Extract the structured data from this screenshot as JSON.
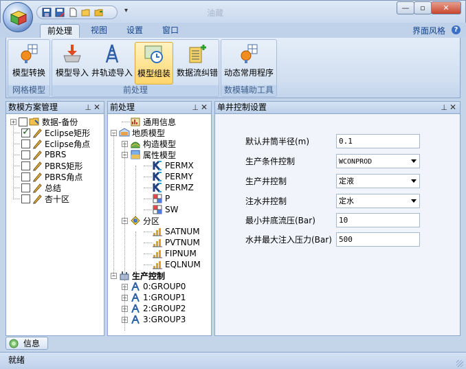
{
  "window": {
    "title": "油藏"
  },
  "qat": {
    "more_label": "▾"
  },
  "ribbon_tabs": [
    "前处理",
    "视图",
    "设置",
    "窗口"
  ],
  "ribbon_right": {
    "style_label": "界面风格",
    "help_label": "?"
  },
  "ribbon": {
    "groups": [
      {
        "label": "网格模型",
        "buttons": [
          "模型转换"
        ]
      },
      {
        "label": "前处理",
        "buttons": [
          "模型导入",
          "井轨迹导入",
          "模型组装",
          "数据流纠错"
        ]
      },
      {
        "label": "数模辅助工具",
        "buttons": [
          "动态常用程序"
        ]
      }
    ],
    "active_button": "模型组装"
  },
  "panels": {
    "scheme": {
      "title": "数模方案管理"
    },
    "pre": {
      "title": "前处理"
    },
    "well": {
      "title": "单井控制设置"
    }
  },
  "scheme_tree": [
    {
      "label": "数据-备份",
      "checked": false
    },
    {
      "label": "Eclipse矩形",
      "checked": true
    },
    {
      "label": "Eclipse角点",
      "checked": false
    },
    {
      "label": "PBRS",
      "checked": false
    },
    {
      "label": "PBRS矩形",
      "checked": false
    },
    {
      "label": "PBRS角点",
      "checked": false
    },
    {
      "label": "总结",
      "checked": false
    },
    {
      "label": "杏十区",
      "checked": false
    }
  ],
  "pre_tree": {
    "general": "通用信息",
    "geo": "地质模型",
    "structure": "构造模型",
    "property": "属性模型",
    "props": [
      "PERMX",
      "PERMY",
      "PERMZ",
      "P",
      "SW"
    ],
    "zone": "分区",
    "zones": [
      "SATNUM",
      "PVTNUM",
      "FIPNUM",
      "EQLNUM"
    ],
    "production": "生产控制",
    "groups": [
      "0:GROUP0",
      "1:GROUP1",
      "2:GROUP2",
      "3:GROUP3"
    ]
  },
  "well_form": {
    "radius_label": "默认井筒半径(m)",
    "radius_value": "0.1",
    "cond_label": "生产条件控制",
    "cond_value": "WCONPROD",
    "prod_label": "生产井控制",
    "prod_value": "定液",
    "inj_label": "注水井控制",
    "inj_value": "定水",
    "min_bhp_label": "最小井底流压(Bar)",
    "min_bhp_value": "10",
    "max_inj_label": "水井最大注入压力(Bar)",
    "max_inj_value": "500"
  },
  "bottom": {
    "info_tab": "信息"
  },
  "status": {
    "text": "就绪"
  }
}
